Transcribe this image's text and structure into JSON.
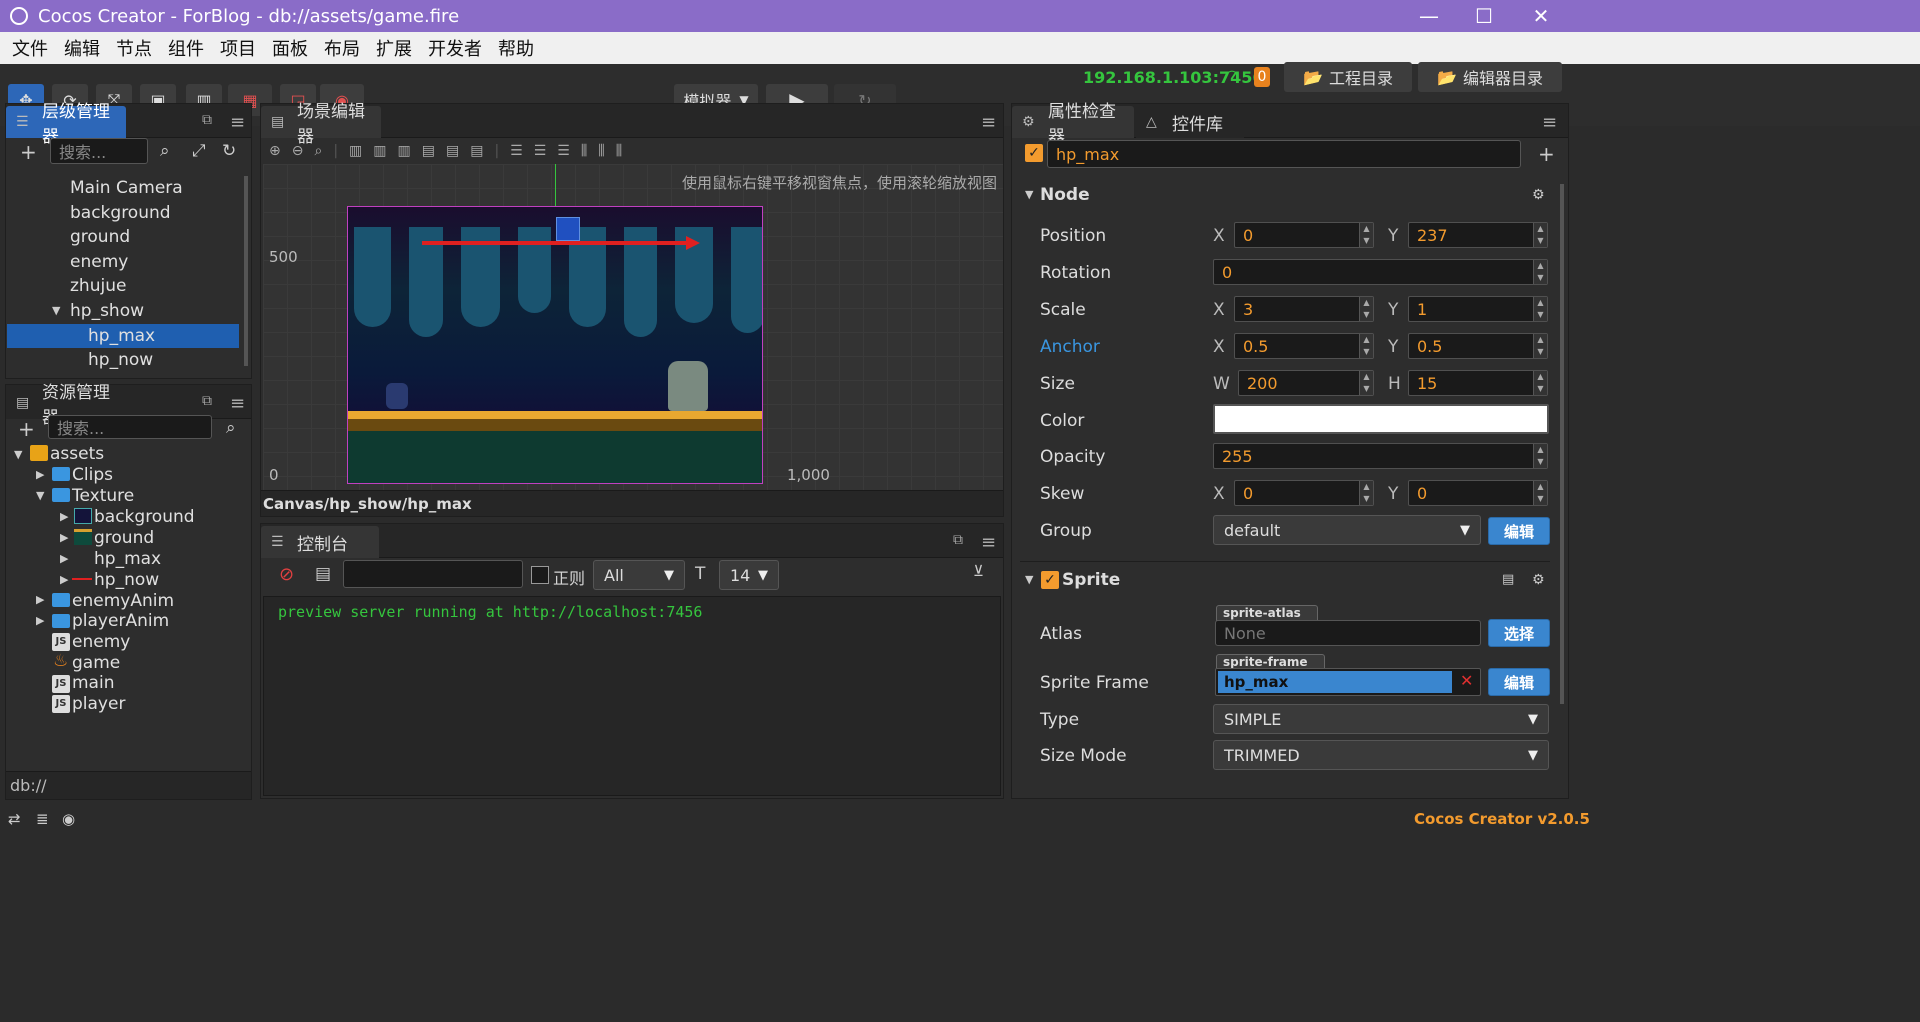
{
  "window": {
    "title": "Cocos Creator - ForBlog - db://assets/game.fire",
    "minimize": "—",
    "maximize": "☐",
    "close": "✕"
  },
  "menu": [
    "文件",
    "编辑",
    "节点",
    "组件",
    "项目",
    "面板",
    "布局",
    "扩展",
    "开发者",
    "帮助"
  ],
  "toolbar": {
    "simulator": "模拟器",
    "ip": "192.168.1.103:7456",
    "badge": "0",
    "project_dir": "工程目录",
    "editor_dir": "编辑器目录"
  },
  "hierarchy": {
    "title": "层级管理器",
    "search_placeholder": "搜索...",
    "items": [
      "Main Camera",
      "background",
      "ground",
      "enemy",
      "zhujue",
      "hp_show",
      "hp_max",
      "hp_now"
    ],
    "selected": "hp_max"
  },
  "assets": {
    "title": "资源管理器",
    "search_placeholder": "搜索...",
    "items": [
      "assets",
      "Clips",
      "Texture",
      "background",
      "ground",
      "hp_max",
      "hp_now",
      "enemyAnim",
      "playerAnim",
      "enemy",
      "game",
      "main",
      "player"
    ],
    "footer": "db://"
  },
  "scene": {
    "title": "场景编辑器",
    "hint": "使用鼠标右键平移视窗焦点，使用滚轮缩放视图",
    "y500": "500",
    "x0": "0",
    "x1000": "1,000",
    "path": "Canvas/hp_show/hp_max"
  },
  "console": {
    "title": "控制台",
    "regex": "正则",
    "filter": "All",
    "fontsize": "14",
    "log": "preview server running at http://localhost:7456"
  },
  "inspector": {
    "tab1": "属性检查器",
    "tab2": "控件库",
    "node_name": "hp_max",
    "node_section": "Node",
    "props": {
      "position": "Position",
      "rotation": "Rotation",
      "scale": "Scale",
      "anchor": "Anchor",
      "size": "Size",
      "color": "Color",
      "opacity": "Opacity",
      "skew": "Skew",
      "group": "Group"
    },
    "values": {
      "pos_x": "0",
      "pos_y": "237",
      "rotation": "0",
      "scale_x": "3",
      "scale_y": "1",
      "anchor_x": "0.5",
      "anchor_y": "0.5",
      "w": "200",
      "h": "15",
      "opacity": "255",
      "skew_x": "0",
      "skew_y": "0",
      "group": "default"
    },
    "axis": {
      "x": "X",
      "y": "Y",
      "w": "W",
      "h": "H"
    },
    "edit": "编辑",
    "select": "选择",
    "sprite": {
      "section": "Sprite",
      "atlas_label": "Atlas",
      "atlas_tag": "sprite-atlas",
      "atlas_value": "None",
      "frame_label": "Sprite Frame",
      "frame_tag": "sprite-frame",
      "frame_value": "hp_max",
      "type_label": "Type",
      "type_value": "SIMPLE",
      "sizemode_label": "Size Mode",
      "sizemode_value": "TRIMMED"
    }
  },
  "status": {
    "version": "Cocos Creator v2.0.5"
  },
  "colors": {
    "accent": "#f39b2e",
    "title_bar": "#8a6cc8",
    "selection": "#1f5fb0",
    "ip_green": "#35c53e"
  }
}
